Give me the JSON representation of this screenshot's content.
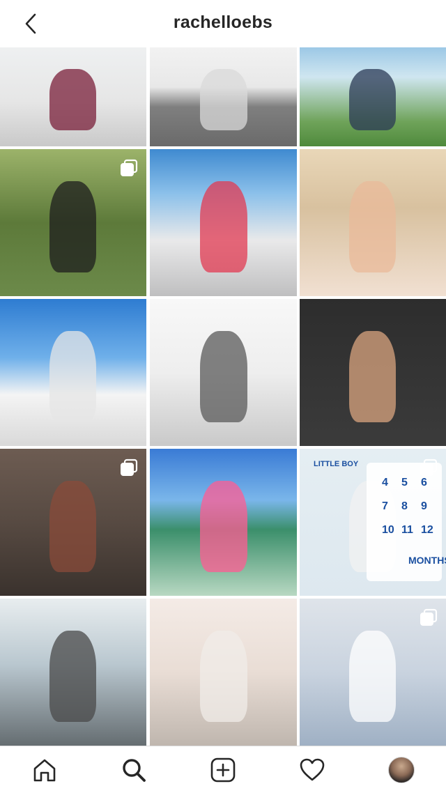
{
  "header": {
    "title": "rachelloebs",
    "back_icon": "chevron-left-icon"
  },
  "grid": {
    "columns": 3,
    "tiles": [
      {
        "name": "post-1",
        "scene": "bg1",
        "multi": false
      },
      {
        "name": "post-2",
        "scene": "bg2",
        "multi": false
      },
      {
        "name": "post-3",
        "scene": "bg3",
        "multi": false
      },
      {
        "name": "post-4",
        "scene": "bg4",
        "multi": true
      },
      {
        "name": "post-5",
        "scene": "bg5",
        "multi": false
      },
      {
        "name": "post-6",
        "scene": "bg6",
        "multi": false
      },
      {
        "name": "post-7",
        "scene": "bg7",
        "multi": false
      },
      {
        "name": "post-8",
        "scene": "bg8",
        "multi": false
      },
      {
        "name": "post-9",
        "scene": "bg9",
        "multi": false
      },
      {
        "name": "post-10",
        "scene": "bg10",
        "multi": true
      },
      {
        "name": "post-11",
        "scene": "bg11",
        "multi": false
      },
      {
        "name": "post-12",
        "scene": "bg12",
        "multi": true
      },
      {
        "name": "post-13",
        "scene": "bg13",
        "multi": false
      },
      {
        "name": "post-14",
        "scene": "bg14",
        "multi": false
      },
      {
        "name": "post-15",
        "scene": "bg15",
        "multi": true
      }
    ],
    "post_12_text": {
      "board_label": "MONTHS",
      "numbers": [
        "4",
        "5",
        "6",
        "7",
        "8",
        "9",
        "10",
        "11",
        "12"
      ],
      "banner": "LITTLE BOY"
    }
  },
  "bottom_nav": {
    "items": [
      {
        "name": "home",
        "icon": "home-icon"
      },
      {
        "name": "search",
        "icon": "search-icon"
      },
      {
        "name": "create",
        "icon": "plus-square-icon"
      },
      {
        "name": "activity",
        "icon": "heart-icon"
      },
      {
        "name": "profile",
        "icon": "avatar"
      }
    ]
  }
}
